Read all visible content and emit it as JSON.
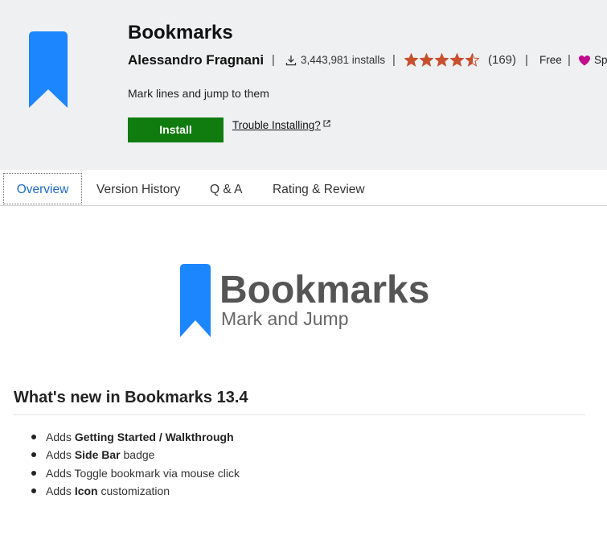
{
  "colors": {
    "header_background": "#eff0f1",
    "brand_blue": "#1c86ff",
    "install_green": "#107c10",
    "star_color": "#c8502f",
    "sponsor_heart": "#c30c8d",
    "tab_active_text": "#1f6bc1",
    "banner_text": "#555555"
  },
  "header": {
    "icon": "bookmark-icon",
    "title": "Bookmarks",
    "publisher": "Alessandro Fragnani",
    "separator": "|",
    "installs_icon": "download-icon",
    "installs": "3,443,981 installs",
    "rating": 4.5,
    "rating_max": 5,
    "rating_count": "(169)",
    "price": "Free",
    "sponsor_icon": "heart-icon",
    "sponsor_label": "Sp",
    "description": "Mark lines and jump to them",
    "install_label": "Install",
    "trouble_link": "Trouble Installing?",
    "trouble_link_icon": "external-link-icon"
  },
  "tabs": [
    {
      "label": "Overview",
      "selected": true
    },
    {
      "label": "Version History",
      "selected": false
    },
    {
      "label": "Q & A",
      "selected": false
    },
    {
      "label": "Rating & Review",
      "selected": false
    }
  ],
  "banner": {
    "icon": "bookmark-icon",
    "title": "Bookmarks",
    "subtitle": "Mark and Jump"
  },
  "whats_new": {
    "heading": "What's new in Bookmarks 13.4",
    "items": [
      {
        "pre": "Adds ",
        "bold": "Getting Started / Walkthrough"
      },
      {
        "pre": "Adds ",
        "bold": "Side Bar",
        "post": " badge"
      },
      {
        "pre": "Adds Toggle bookmark via mouse click"
      },
      {
        "pre": "Adds ",
        "bold": "Icon",
        "post": " customization"
      }
    ]
  }
}
